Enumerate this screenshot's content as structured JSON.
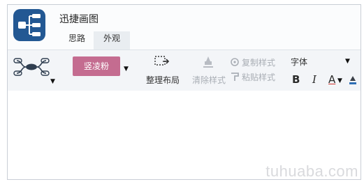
{
  "app": {
    "title": "迅捷画图"
  },
  "tabs": [
    {
      "label": "思路"
    },
    {
      "label": "外观"
    }
  ],
  "toolbar": {
    "theme_color_label": "竖凌粉",
    "theme_color": "#c46c90",
    "tidy_layout_label": "整理布局",
    "clear_style_label": "清除样式",
    "copy_style_label": "复制样式",
    "paste_style_label": "粘贴样式",
    "font_label": "字体",
    "bold": "B",
    "italic": "I",
    "font_color": "A"
  },
  "watermark": "tuhuaba.com"
}
